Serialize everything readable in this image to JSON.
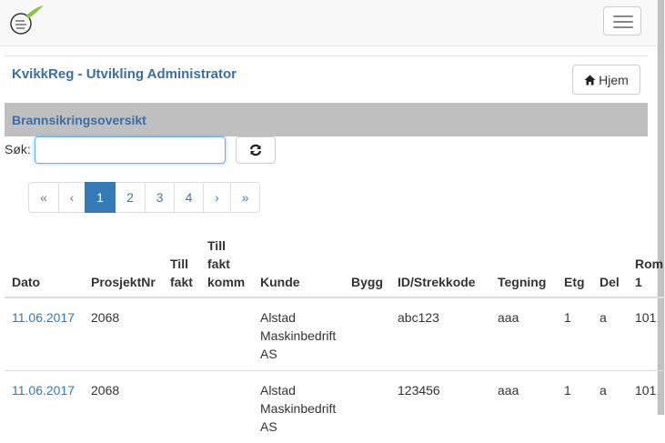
{
  "navbar": {
    "logo_icon": "feather-logo-icon",
    "toggle_icon": "hamburger-menu-icon"
  },
  "header": {
    "app_title": "KvikkReg - Utvikling Administrator",
    "home_label": "Hjem",
    "home_icon": "home-icon"
  },
  "section": {
    "title": "Brannsikringsoversikt"
  },
  "search": {
    "label": "Søk:",
    "value": "",
    "refresh_icon": "refresh-icon"
  },
  "pagination": {
    "first": "«",
    "prev": "‹",
    "pages": [
      "1",
      "2",
      "3",
      "4"
    ],
    "active": "1",
    "next": "›",
    "last": "»"
  },
  "table": {
    "headers": [
      "Dato",
      "ProsjektNr",
      "Till fakt",
      "Till fakt komm",
      "Kunde",
      "Bygg",
      "ID/Strekkode",
      "Tegning",
      "Etg",
      "Del",
      "Rom 1"
    ],
    "rows": [
      [
        "11.06.2017",
        "2068",
        "",
        "",
        "Alstad Maskinbedrift AS",
        "",
        "abc123",
        "aaa",
        "1",
        "a",
        "101"
      ],
      [
        "11.06.2017",
        "2068",
        "",
        "",
        "Alstad Maskinbedrift AS",
        "",
        "123456",
        "aaa",
        "1",
        "a",
        "101"
      ]
    ]
  },
  "colors": {
    "accent": "#337ab7",
    "title": "#3a6ea5",
    "section_bg": "#bfbfbf"
  }
}
